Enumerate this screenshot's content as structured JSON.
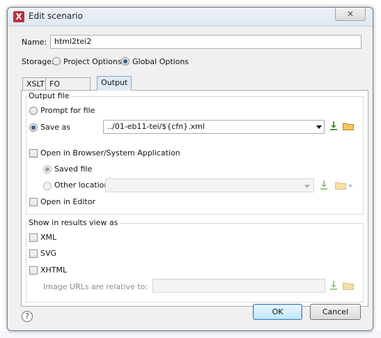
{
  "dialog": {
    "title": "Edit scenario",
    "close_label": "✕"
  },
  "name": {
    "label": "Name:",
    "value": "html2tei2"
  },
  "storage": {
    "label": "Storage:",
    "options": [
      {
        "label": "Project Options",
        "selected": false
      },
      {
        "label": "Global Options",
        "selected": true
      }
    ]
  },
  "tabs": [
    {
      "label": "XSLT",
      "active": false
    },
    {
      "label": "FO Processor",
      "active": false
    },
    {
      "label": "Output",
      "active": true
    }
  ],
  "output_file": {
    "group_label": "Output file",
    "prompt_label": "Prompt for file",
    "save_as_label": "Save as",
    "save_as_value": "../01-eb11-tei/${cfn}.xml",
    "open_browser_label": "Open in Browser/System Application",
    "saved_file_label": "Saved file",
    "other_location_label": "Other location",
    "other_location_value": "",
    "open_editor_label": "Open in Editor"
  },
  "results_view": {
    "group_label": "Show in results view as",
    "xml_label": "XML",
    "svg_label": "SVG",
    "xhtml_label": "XHTML",
    "image_urls_label": "Image URLs are relative to:",
    "image_urls_value": ""
  },
  "footer": {
    "help_label": "?",
    "ok_label": "OK",
    "cancel_label": "Cancel"
  },
  "colors": {
    "accent": "#3c7fb1",
    "insert_icon": "#4a9a2a",
    "folder_icon": "#e8b53a"
  },
  "icons": [
    "app-icon",
    "close-icon",
    "insert-editor-variables-icon",
    "folder-icon",
    "help-icon",
    "chevron-down-icon"
  ]
}
